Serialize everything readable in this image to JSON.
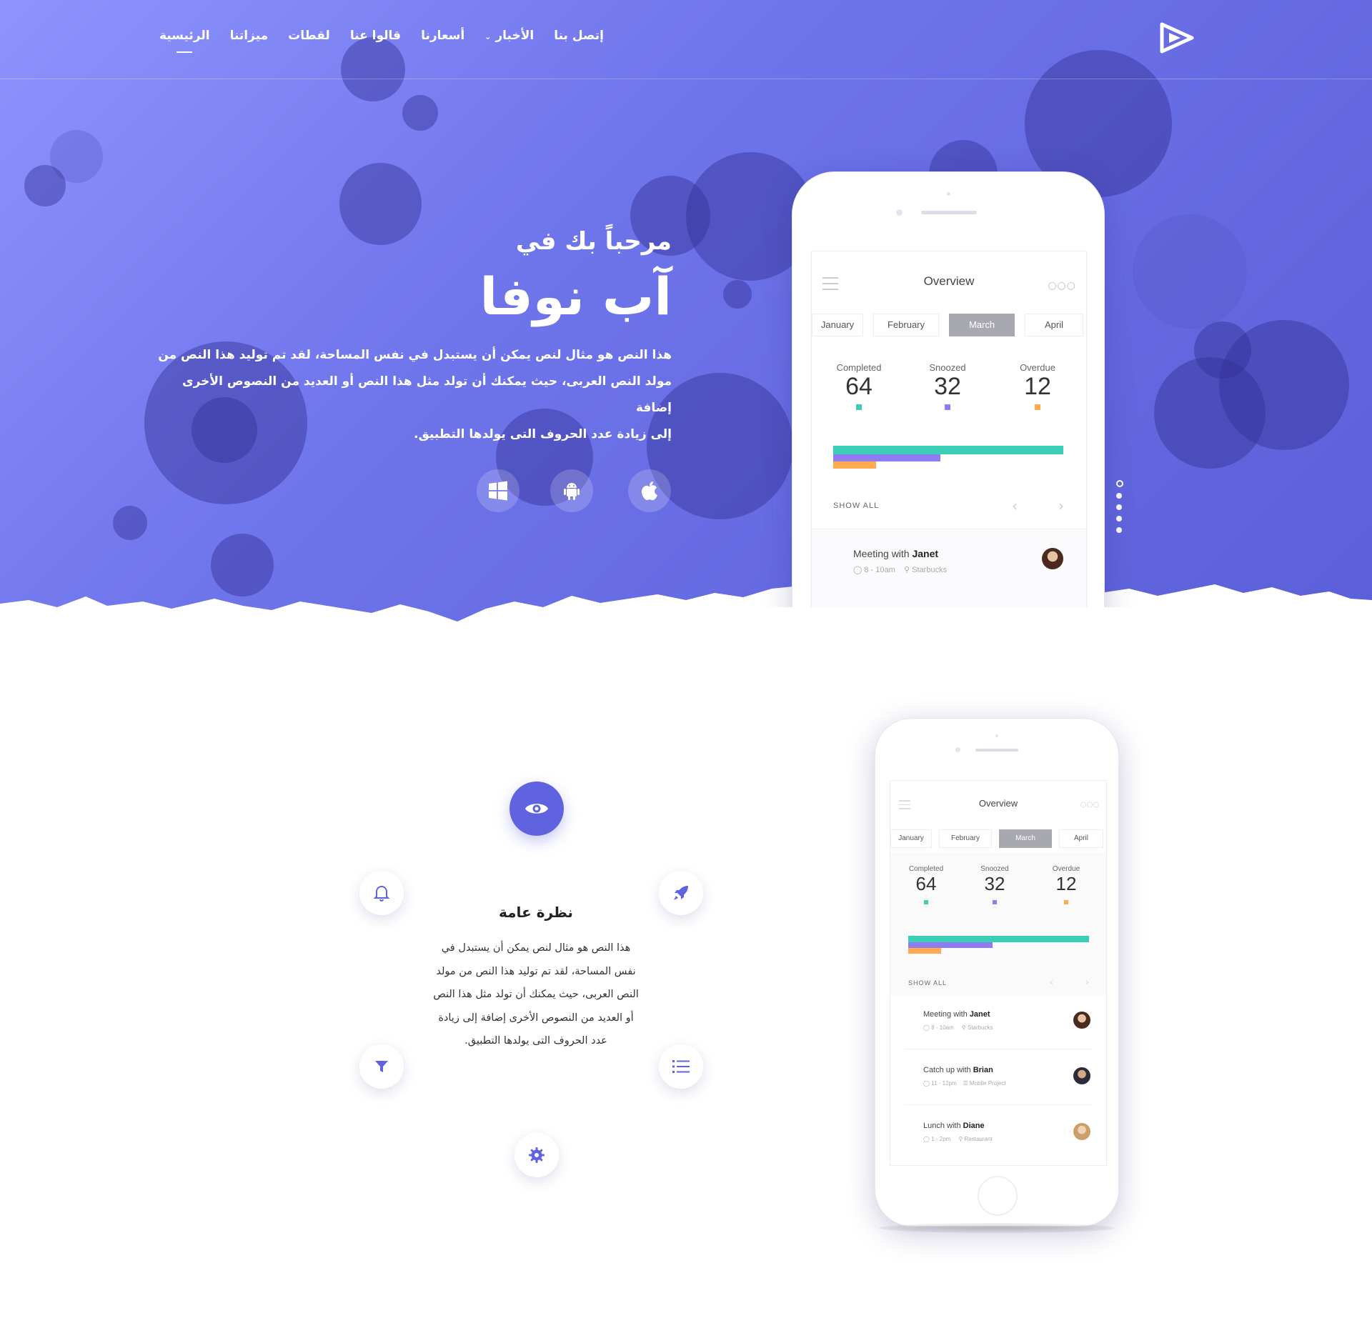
{
  "nav": {
    "items": [
      {
        "label": "الرئيسية",
        "active": true
      },
      {
        "label": "ميزاتنا"
      },
      {
        "label": "لقطات"
      },
      {
        "label": "قالوا عنا"
      },
      {
        "label": "أسعارنا"
      },
      {
        "label": "الأخبار",
        "dropdown": true
      },
      {
        "label": "إتصل بنا"
      }
    ],
    "dropdown_icon": "chevron-down-icon",
    "logo_icon": "play-triangle-logo"
  },
  "hero": {
    "welcome": "مرحباً بك في",
    "title": "آب نوفا",
    "description_lines": [
      "هذا النص هو مثال لنص يمكن أن يستبدل في نفس المساحة، لقد تم توليد هذا النص من",
      "مولد النص العربى، حيث يمكنك أن تولد مثل هذا النص أو العديد من النصوص الأخرى إضافة",
      "إلى زيادة عدد الحروف التى يولدها التطبيق."
    ],
    "store_icons": [
      "windows-icon",
      "android-icon",
      "apple-icon"
    ],
    "pager_dots": 5,
    "pager_active": 0
  },
  "phone_hero": {
    "title": "Overview",
    "months": [
      "January",
      "February",
      "March",
      "April"
    ],
    "selected_month": "March",
    "stats": [
      {
        "label": "Completed",
        "value": "64",
        "color": "#3ccfb8"
      },
      {
        "label": "Snoozed",
        "value": "32",
        "color": "#8e7cf0"
      },
      {
        "label": "Overdue",
        "value": "12",
        "color": "#ffab4d"
      }
    ],
    "show_all": "SHOW ALL",
    "meetings": [
      {
        "prefix": "Meeting with ",
        "name": "Janet",
        "time": "8 - 10am",
        "place": "Starbucks"
      }
    ]
  },
  "phone_feature": {
    "title": "Overview",
    "months": [
      "January",
      "February",
      "March",
      "April"
    ],
    "selected_month": "March",
    "stats": [
      {
        "label": "Completed",
        "value": "64",
        "color": "#3ccfb8"
      },
      {
        "label": "Snoozed",
        "value": "32",
        "color": "#8e7cf0"
      },
      {
        "label": "Overdue",
        "value": "12",
        "color": "#ffab4d"
      }
    ],
    "show_all": "SHOW ALL",
    "meetings": [
      {
        "prefix": "Meeting with ",
        "name": "Janet",
        "time": "8 - 10am",
        "place": "Starbucks"
      },
      {
        "prefix": "Catch up with ",
        "name": "Brian",
        "time": "11 - 12pm",
        "place": "Mobile Project"
      },
      {
        "prefix": "Lunch with ",
        "name": "Diane",
        "time": "1 - 2pm",
        "place": "Restaurant"
      }
    ]
  },
  "features": {
    "title": "نظرة عامة",
    "description_lines": [
      "هذا النص هو مثال لنص يمكن أن يستبدل في",
      "نفس المساحة، لقد تم توليد هذا النص من مولد",
      "النص العربى، حيث يمكنك أن تولد مثل هذا النص",
      "أو العديد من النصوص الأخرى إضافة إلى زيادة",
      "عدد الحروف التى يولدها التطبيق."
    ],
    "center_icon": "eye-icon",
    "icons": [
      "bell-icon",
      "rocket-icon",
      "filter-icon",
      "list-icon",
      "gear-icon"
    ]
  },
  "colors": {
    "accent": "#6063e0",
    "hero_gradient_start": "#8e93ff",
    "hero_gradient_end": "#5b5fd8"
  }
}
